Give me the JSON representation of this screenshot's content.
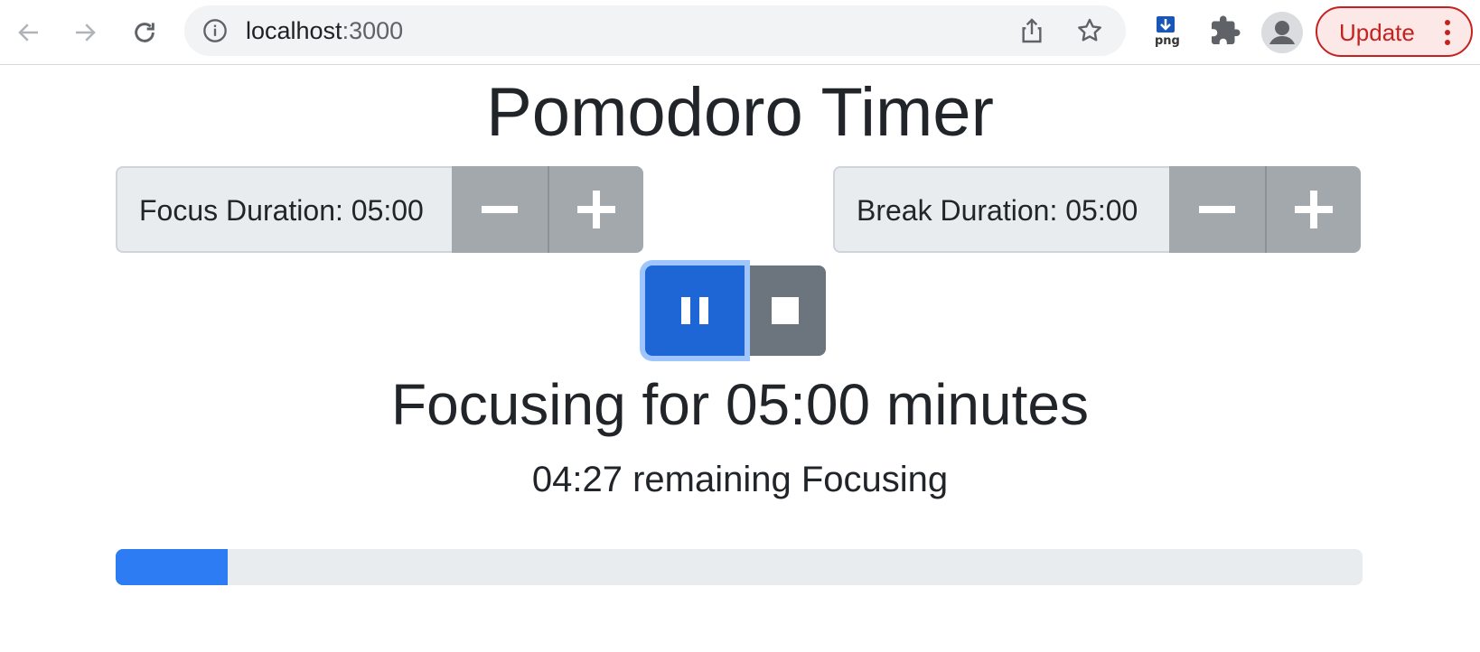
{
  "browser": {
    "url_host": "localhost",
    "url_port": ":3000",
    "update_label": "Update",
    "extension_label": "png"
  },
  "page": {
    "title": "Pomodoro Timer",
    "focus": {
      "label": "Focus Duration: 05:00"
    },
    "break": {
      "label": "Break Duration: 05:00"
    },
    "status_heading": "Focusing for 05:00 minutes",
    "remaining_text": "04:27 remaining Focusing",
    "progress_fraction": 0.09
  },
  "colors": {
    "primary": "#1e66d5",
    "secondary": "#6c757d",
    "progress": "#2d7cf3",
    "update": "#c5221f"
  }
}
